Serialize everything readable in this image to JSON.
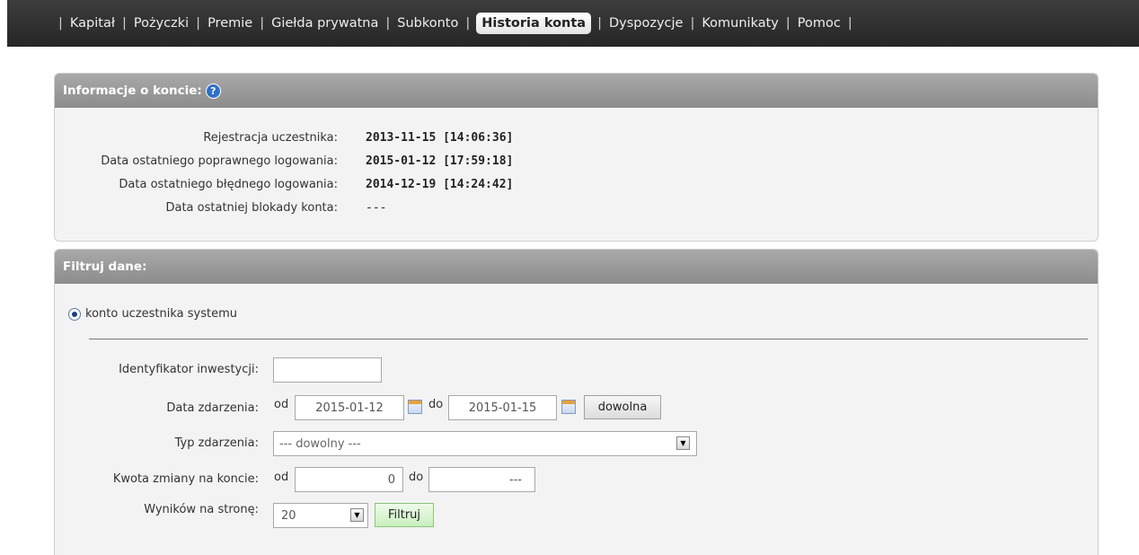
{
  "nav": {
    "items": [
      {
        "label": "Kapitał",
        "active": false
      },
      {
        "label": "Pożyczki",
        "active": false
      },
      {
        "label": "Premie",
        "active": false
      },
      {
        "label": "Giełda prywatna",
        "active": false
      },
      {
        "label": "Subkonto",
        "active": false
      },
      {
        "label": "Historia konta",
        "active": true
      },
      {
        "label": "Dyspozycje",
        "active": false
      },
      {
        "label": "Komunikaty",
        "active": false
      },
      {
        "label": "Pomoc",
        "active": false
      }
    ],
    "separator": "|"
  },
  "info_panel": {
    "title": "Informacje o koncie:",
    "help_icon": "?",
    "rows": [
      {
        "label": "Rejestracja uczestnika:",
        "value": "2013-11-15 [14:06:36]"
      },
      {
        "label": "Data ostatniego poprawnego logowania:",
        "value": "2015-01-12 [17:59:18]"
      },
      {
        "label": "Data ostatniego błędnego logowania:",
        "value": "2014-12-19 [14:24:42]"
      },
      {
        "label": "Data ostatniej blokady konta:",
        "value": "---"
      }
    ]
  },
  "filter_panel": {
    "title": "Filtruj dane:",
    "radio_label": "konto uczestnika systemu",
    "id_label": "Identyfikator inwestycji:",
    "id_value": "",
    "date_label": "Data zdarzenia:",
    "from_label": "od",
    "to_label": "do",
    "date_from": "2015-01-12",
    "date_to": "2015-01-15",
    "any_date_button": "dowolna",
    "type_label": "Typ zdarzenia:",
    "type_value": "--- dowolny ---",
    "amount_label": "Kwota zmiany na koncie:",
    "amount_from": "0",
    "amount_to": "---",
    "per_page_label": "Wyników na stronę:",
    "per_page_value": "20",
    "filter_button": "Filtruj"
  }
}
